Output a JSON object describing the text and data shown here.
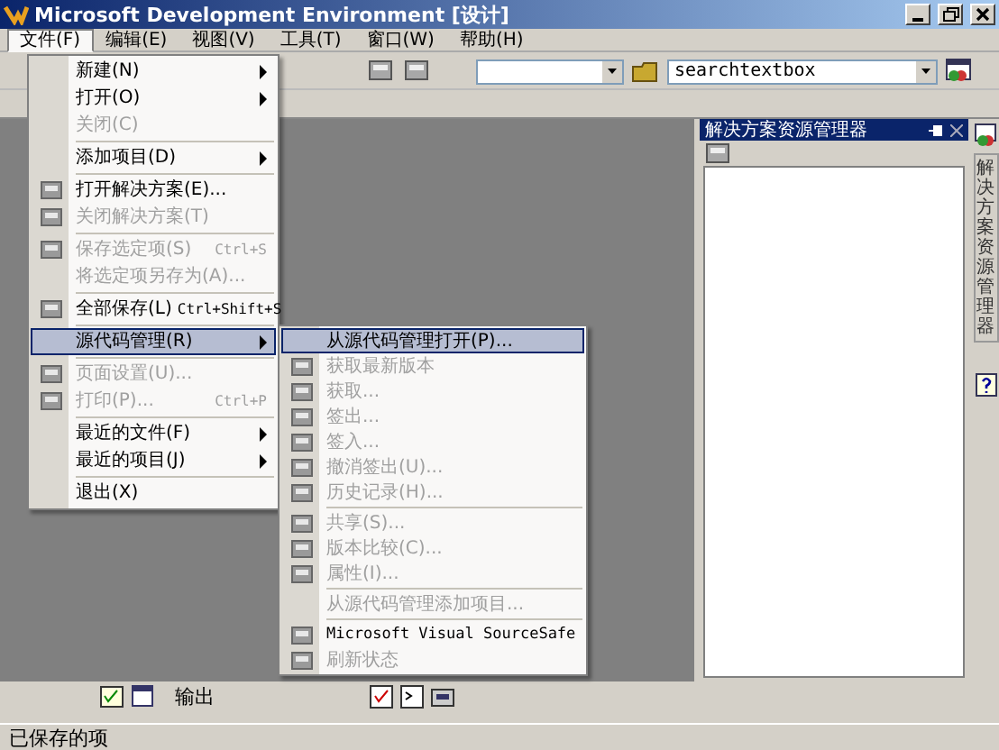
{
  "window": {
    "title": "Microsoft Development Environment [设计]"
  },
  "menubar": [
    {
      "label": "文件(F)",
      "selected": true
    },
    {
      "label": "编辑(E)",
      "selected": false
    },
    {
      "label": "视图(V)",
      "selected": false
    },
    {
      "label": "工具(T)",
      "selected": false
    },
    {
      "label": "窗口(W)",
      "selected": false
    },
    {
      "label": "帮助(H)",
      "selected": false
    }
  ],
  "toolbar": {
    "search_combo": {
      "value": "searchtextbox"
    }
  },
  "file_menu": {
    "items": [
      {
        "kind": "item",
        "label": "新建(N)",
        "disabled": false,
        "has_submenu": true,
        "has_icon": false,
        "selected": false
      },
      {
        "kind": "item",
        "label": "打开(O)",
        "disabled": false,
        "has_submenu": true,
        "has_icon": false,
        "selected": false
      },
      {
        "kind": "item",
        "label": "关闭(C)",
        "disabled": true,
        "has_submenu": false,
        "has_icon": false,
        "selected": false
      },
      {
        "kind": "separator"
      },
      {
        "kind": "item",
        "label": "添加项目(D)",
        "disabled": false,
        "has_submenu": true,
        "has_icon": false,
        "selected": false
      },
      {
        "kind": "separator"
      },
      {
        "kind": "item",
        "label": "打开解决方案(E)...",
        "disabled": false,
        "has_submenu": false,
        "has_icon": true,
        "selected": false
      },
      {
        "kind": "item",
        "label": "关闭解决方案(T)",
        "disabled": true,
        "has_submenu": false,
        "has_icon": true,
        "selected": false
      },
      {
        "kind": "separator"
      },
      {
        "kind": "item",
        "label": "保存选定项(S)",
        "shortcut": "Ctrl+S",
        "disabled": true,
        "has_submenu": false,
        "has_icon": true,
        "selected": false
      },
      {
        "kind": "item",
        "label": "将选定项另存为(A)...",
        "disabled": true,
        "has_submenu": false,
        "has_icon": false,
        "selected": false
      },
      {
        "kind": "separator"
      },
      {
        "kind": "item",
        "label": "全部保存(L)",
        "shortcut": "Ctrl+Shift+S",
        "disabled": false,
        "has_submenu": false,
        "has_icon": true,
        "selected": false
      },
      {
        "kind": "separator"
      },
      {
        "kind": "item",
        "label": "源代码管理(R)",
        "disabled": false,
        "has_submenu": true,
        "has_icon": false,
        "selected": true
      },
      {
        "kind": "separator"
      },
      {
        "kind": "item",
        "label": "页面设置(U)...",
        "disabled": true,
        "has_submenu": false,
        "has_icon": true,
        "selected": false
      },
      {
        "kind": "item",
        "label": "打印(P)...",
        "shortcut": "Ctrl+P",
        "disabled": true,
        "has_submenu": false,
        "has_icon": true,
        "selected": false
      },
      {
        "kind": "separator"
      },
      {
        "kind": "item",
        "label": "最近的文件(F)",
        "disabled": false,
        "has_submenu": true,
        "has_icon": false,
        "selected": false
      },
      {
        "kind": "item",
        "label": "最近的项目(J)",
        "disabled": false,
        "has_submenu": true,
        "has_icon": false,
        "selected": false
      },
      {
        "kind": "separator"
      },
      {
        "kind": "item",
        "label": "退出(X)",
        "disabled": false,
        "has_submenu": false,
        "has_icon": false,
        "selected": false
      }
    ]
  },
  "source_menu": {
    "items": [
      {
        "kind": "item",
        "label": "从源代码管理打开(P)...",
        "disabled": false,
        "has_icon": false,
        "selected": true
      },
      {
        "kind": "item",
        "label": "获取最新版本",
        "disabled": true,
        "has_icon": true,
        "selected": false
      },
      {
        "kind": "item",
        "label": "获取...",
        "disabled": true,
        "has_icon": true,
        "selected": false
      },
      {
        "kind": "item",
        "label": "签出...",
        "disabled": true,
        "has_icon": true,
        "selected": false
      },
      {
        "kind": "item",
        "label": "签入...",
        "disabled": true,
        "has_icon": true,
        "selected": false
      },
      {
        "kind": "item",
        "label": "撤消签出(U)...",
        "disabled": true,
        "has_icon": true,
        "selected": false
      },
      {
        "kind": "item",
        "label": "历史记录(H)...",
        "disabled": true,
        "has_icon": true,
        "selected": false
      },
      {
        "kind": "separator"
      },
      {
        "kind": "item",
        "label": "共享(S)...",
        "disabled": true,
        "has_icon": true,
        "selected": false
      },
      {
        "kind": "item",
        "label": "版本比较(C)...",
        "disabled": true,
        "has_icon": true,
        "selected": false
      },
      {
        "kind": "item",
        "label": "属性(I)...",
        "disabled": true,
        "has_icon": true,
        "selected": false
      },
      {
        "kind": "separator"
      },
      {
        "kind": "item",
        "label": "从源代码管理添加项目...",
        "disabled": true,
        "has_icon": false,
        "selected": false
      },
      {
        "kind": "separator"
      },
      {
        "kind": "item",
        "label": "Microsoft Visual SourceSafe",
        "disabled": false,
        "has_icon": true,
        "selected": false
      },
      {
        "kind": "item",
        "label": "刷新状态",
        "disabled": true,
        "has_icon": true,
        "selected": false
      }
    ]
  },
  "solution_explorer": {
    "title": "解决方案资源管理器"
  },
  "side_tab": {
    "label": "解决方案资源管理器"
  },
  "bottom_tabs": [
    {
      "label": "输出"
    }
  ],
  "status_bar": {
    "text": "已保存的项"
  }
}
